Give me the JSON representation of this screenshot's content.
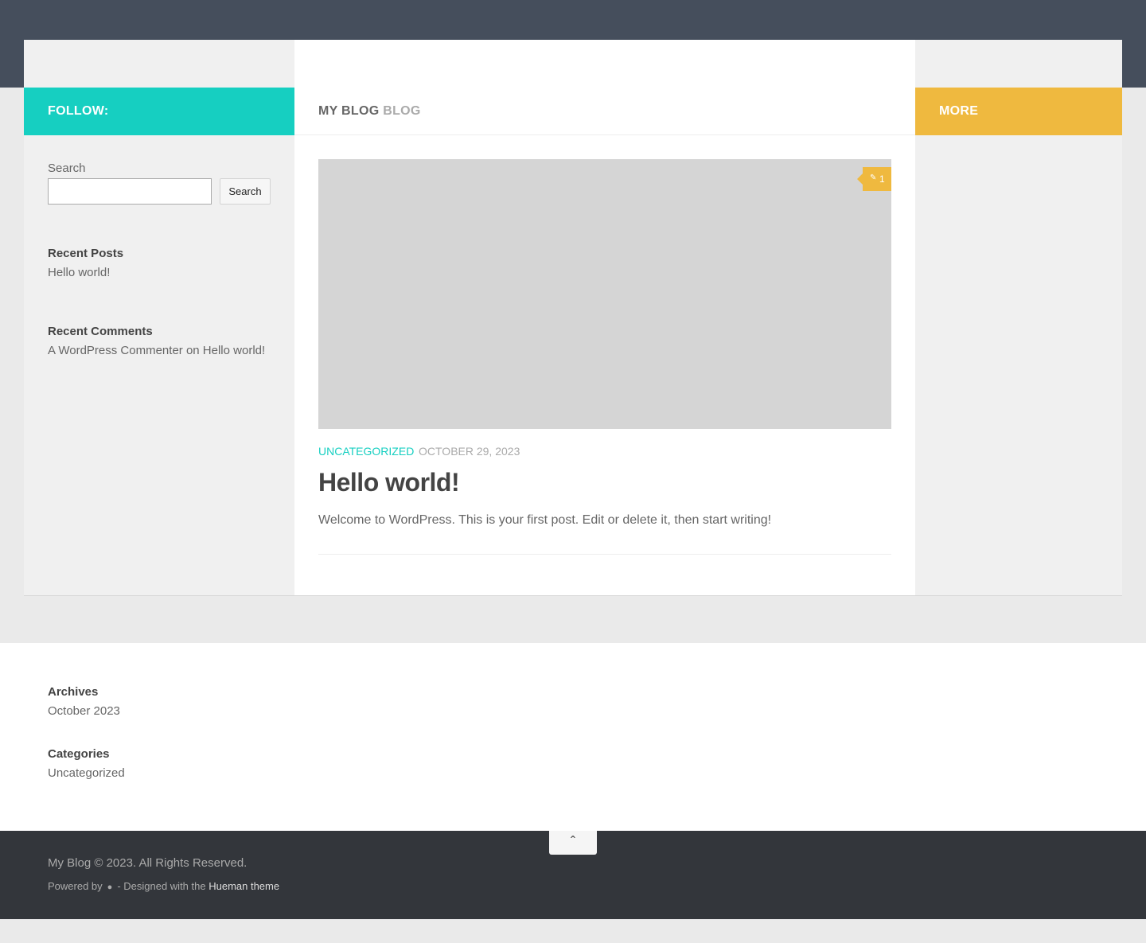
{
  "sidebar_left": {
    "header": "FOLLOW:",
    "search": {
      "label": "Search",
      "value": "",
      "placeholder": "",
      "button": "Search"
    },
    "recent_posts": {
      "title": "Recent Posts",
      "items": [
        "Hello world!"
      ]
    },
    "recent_comments": {
      "title": "Recent Comments",
      "items": [
        "A WordPress Commenter on Hello world!"
      ]
    }
  },
  "main": {
    "header_part1": "MY BLOG",
    "header_part2": "BLOG",
    "post": {
      "comments_count": "1",
      "category": "UNCATEGORIZED",
      "date": "OCTOBER 29, 2023",
      "title": "Hello world!",
      "excerpt": "Welcome to WordPress. This is your first post. Edit or delete it, then start writing!"
    }
  },
  "sidebar_right": {
    "header": "MORE"
  },
  "footer_widgets": {
    "archives": {
      "title": "Archives",
      "items": [
        "October 2023"
      ]
    },
    "categories": {
      "title": "Categories",
      "items": [
        "Uncategorized"
      ]
    }
  },
  "footer": {
    "copyright": "My Blog © 2023. All Rights Reserved.",
    "powered_by": "Powered by",
    "designed_with": "- Designed with the",
    "theme_link": "Hueman theme"
  },
  "colors": {
    "topbar": "#454e5c",
    "accent_teal": "#16cfc1",
    "accent_orange": "#efb93f",
    "footer_dark": "#33363b"
  },
  "icons": {
    "comment": "comment-icon",
    "wordpress": "wordpress-icon",
    "back_to_top": "chevron-up-icon"
  }
}
